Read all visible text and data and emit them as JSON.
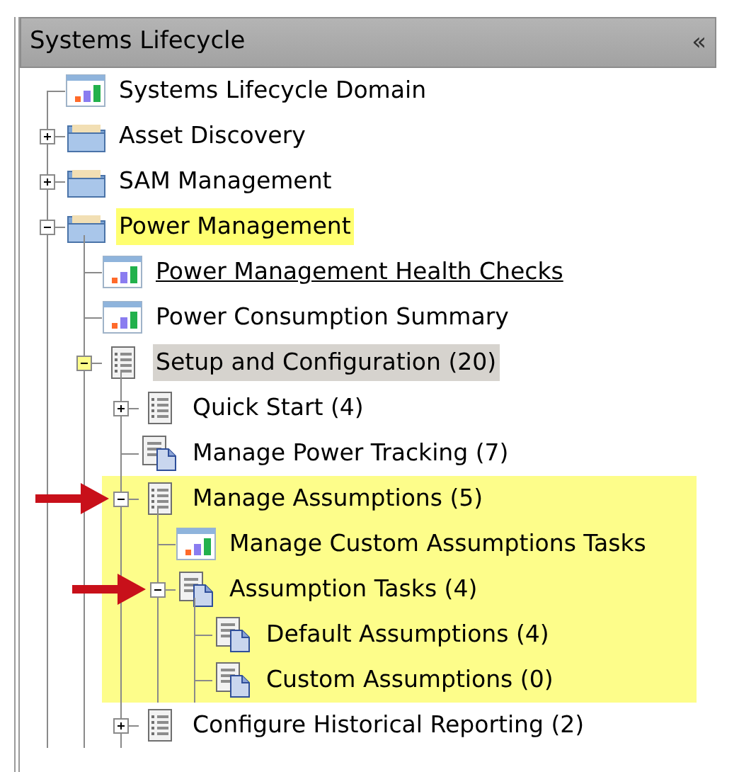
{
  "panel": {
    "title": "Systems Lifecycle",
    "collapse": "«"
  },
  "tree": [
    {
      "label": "Systems Lifecycle Domain",
      "kind": "report",
      "selected": false,
      "highlighted": false,
      "underlined": false,
      "marked": false
    },
    {
      "label": "Asset Discovery",
      "kind": "folder",
      "expanded": false,
      "toggle_highlighted": false,
      "selected": false,
      "highlighted": false,
      "underlined": false,
      "marked": false
    },
    {
      "label": "SAM Management",
      "kind": "folder",
      "expanded": false,
      "toggle_highlighted": false,
      "selected": false,
      "highlighted": false,
      "underlined": false,
      "marked": false
    },
    {
      "label": "Power Management",
      "kind": "folder",
      "expanded": true,
      "toggle_highlighted": false,
      "selected": false,
      "highlighted": true,
      "underlined": false,
      "marked": false,
      "children": [
        {
          "label": "Power Management Health Checks",
          "kind": "report",
          "selected": false,
          "highlighted": false,
          "underlined": true,
          "marked": false
        },
        {
          "label": "Power Consumption Summary",
          "kind": "report",
          "selected": false,
          "highlighted": false,
          "underlined": false,
          "marked": false
        },
        {
          "label": "Setup and Configuration (20)",
          "kind": "list",
          "expanded": true,
          "toggle_highlighted": true,
          "selected": true,
          "highlighted": false,
          "underlined": false,
          "marked": false,
          "children": [
            {
              "label": "Quick Start (4)",
              "kind": "list",
              "expanded": false,
              "toggle_highlighted": false,
              "selected": false,
              "highlighted": false,
              "underlined": false,
              "marked": false
            },
            {
              "label": "Manage Power Tracking (7)",
              "kind": "doc-list",
              "selected": false,
              "highlighted": false,
              "underlined": false,
              "marked": false
            },
            {
              "label": "Manage Assumptions (5)",
              "kind": "list",
              "expanded": true,
              "toggle_highlighted": false,
              "band_highlighted": true,
              "selected": false,
              "highlighted": false,
              "underlined": false,
              "marked": true,
              "children": [
                {
                  "label": "Manage Custom Assumptions Tasks",
                  "kind": "report",
                  "selected": false,
                  "highlighted": false,
                  "underlined": false,
                  "marked": false
                },
                {
                  "label": "Assumption Tasks (4)",
                  "kind": "doc-list",
                  "expanded": true,
                  "toggle_highlighted": false,
                  "selected": false,
                  "highlighted": false,
                  "underlined": false,
                  "marked": true,
                  "children": [
                    {
                      "label": "Default Assumptions (4)",
                      "kind": "doc-list",
                      "selected": false,
                      "highlighted": false,
                      "underlined": false,
                      "marked": false
                    },
                    {
                      "label": "Custom Assumptions (0)",
                      "kind": "doc-list",
                      "selected": false,
                      "highlighted": false,
                      "underlined": false,
                      "marked": false
                    }
                  ]
                }
              ]
            },
            {
              "label": "Configure Historical Reporting (2)",
              "kind": "list",
              "expanded": false,
              "toggle_highlighted": false,
              "selected": false,
              "highlighted": false,
              "underlined": false,
              "marked": false
            }
          ]
        }
      ]
    }
  ]
}
